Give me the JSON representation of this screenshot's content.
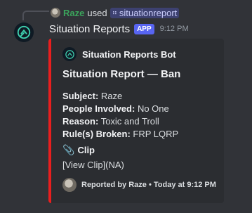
{
  "interaction": {
    "user": "Raze",
    "used": "used",
    "command": "situationreport",
    "command_icon": "slash-command-icon"
  },
  "message": {
    "author": "Situation Reports",
    "app_badge": "APP",
    "timestamp": "9:12 PM"
  },
  "embed": {
    "accent_color": "#e91e1e",
    "author_name": "Situation Reports Bot",
    "title": "Situation Report — Ban",
    "fields": [
      {
        "key": "Subject:",
        "value": "Raze"
      },
      {
        "key": "People Involved:",
        "value": "No One"
      },
      {
        "key": "Reason:",
        "value": "Toxic and Troll"
      },
      {
        "key": "Rule(s) Broken:",
        "value": "FRP LQRP"
      }
    ],
    "clip_heading": "Clip",
    "clip_icon": "paperclip-icon",
    "clip_link": "[View Clip](NA)",
    "footer": "Reported by Raze • Today at 9:12 PM"
  }
}
